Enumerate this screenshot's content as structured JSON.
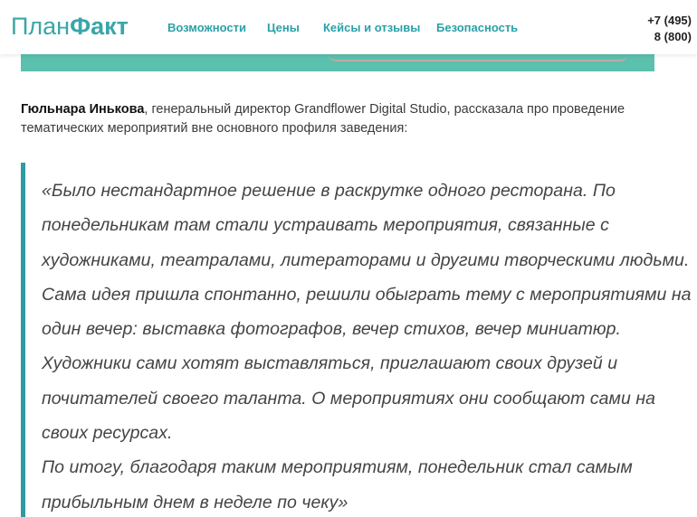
{
  "header": {
    "logo": {
      "part1": "План",
      "part2": "Факт"
    },
    "nav": [
      {
        "label": "Возможности"
      },
      {
        "label": "Цены"
      },
      {
        "label": "Кейсы и отзывы"
      },
      {
        "label": "Безопасность"
      }
    ],
    "phones": [
      "+7 (495)",
      "8 (800)"
    ]
  },
  "article": {
    "intro": {
      "name": "Гюльнара Инькова",
      "text": ", генеральный директор Grandflower Digital Studio, рассказала про проведение тематических мероприятий вне основного профиля заведения:"
    },
    "quote_lines": [
      "«Было нестандартное решение в раскрутке одного ресторана. По",
      "понедельникам там стали устраивать мероприятия, связанные с",
      "художниками, театралами, литераторами и другими творческими людьми.",
      "Сама идея пришла спонтанно, решили обыграть тему с мероприятиями на",
      "один вечер: выставка фотографов, вечер стихов, вечер миниатюр.",
      "Художники сами хотят выставляться, приглашают своих друзей и",
      "почитателей своего таланта. О мероприятиях они сообщают сами на",
      "своих ресурсах.",
      "По итогу, благодаря таким мероприятиям, понедельник стал самым",
      "прибыльным днем в неделе по чеку»"
    ]
  },
  "colors": {
    "brand": "#3aa6a8",
    "nav": "#2aa1a8",
    "banner": "#5cc0ae",
    "quote_bar": "#2e9aa3"
  }
}
